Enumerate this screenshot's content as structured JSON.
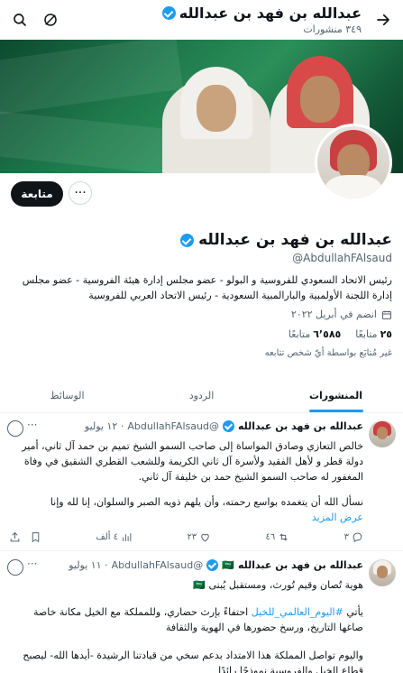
{
  "header": {
    "name": "عبدالله بن فهد بن عبدالله",
    "post_count": "٣٤٩ منشورات"
  },
  "profile": {
    "name": "عبدالله بن فهد بن عبدالله",
    "handle": "@AbdullahFAlsaud",
    "bio": "رئيس الاتحاد السعودي للفروسية و البولو - عضو مجلس إدارة هيئة الفروسية - عضو مجلس إدارة اللجنة الأولمبية والبارالمبية السعودية - رئيس الاتحاد العربي للفروسية",
    "joined": "انضم في أبريل ٢٠٢٢",
    "following_count": "٢٥",
    "following_label": "متابعًا",
    "followers_count": "٦٬٥٨٥",
    "followers_label": "متابعًا",
    "followers_note": "غير مُتابَع بواسطة أيّ شخص تتابعه",
    "follow_label": "متابعة",
    "more_label": "···"
  },
  "tabs": [
    {
      "label": "المنشورات"
    },
    {
      "label": "الردود"
    },
    {
      "label": "الوسائط"
    }
  ],
  "tweets": [
    {
      "name": "عبدالله بن فهد بن عبدالله",
      "handle": "@AbdullahFAlsaud",
      "date": "· ١٢ يوليو",
      "line1": "خالص التعازي وصادق المواساة إلى صاحب السمو الشيخ تميم بن حمد آل ثاني، أمير دولة قطر و لأهل الفقيد ولأسرة آل ثاني الكريمة وللشعب القطري الشقيق في وفاة المغفور له صاحب السمو الشيخ حمد بن خليفة آل ثاني.",
      "line2": "نسأل الله أن يتغمده بواسع رحمته، وأن يلهم ذويه الصبر والسلوان، إنا لله وإنا",
      "show_more": "عرض المزيد",
      "replies": "٣",
      "retweets": "٤٦",
      "likes": "٢٣",
      "views": "٤ ألف"
    },
    {
      "name": "عبدالله بن فهد بن عبدالله",
      "flag": "🇸🇦",
      "handle": "@AbdullahFAlsaud",
      "date": "· ١١ يوليو",
      "line1": "هوية تُصان وقيم تُورث، ومستقبل يُبنى 🇸🇦",
      "hashtag": "#اليوم_العالمي_للخيل",
      "line2_prefix": "يأتي",
      "line2_rest": " احتفاءً بإرث حضاري، وللمملكة مع الخيل مكانة خاصة صاغها التاريخ، ورسخ حضورها في الهوية والثقافة",
      "line3": "واليوم تواصل المملكة هذا الامتداد بدعم سخي من قيادتنا الرشيدة -أيدها الله- ليصبح قطاع الخيل والفروسية نموذجًا رائدًا"
    }
  ]
}
